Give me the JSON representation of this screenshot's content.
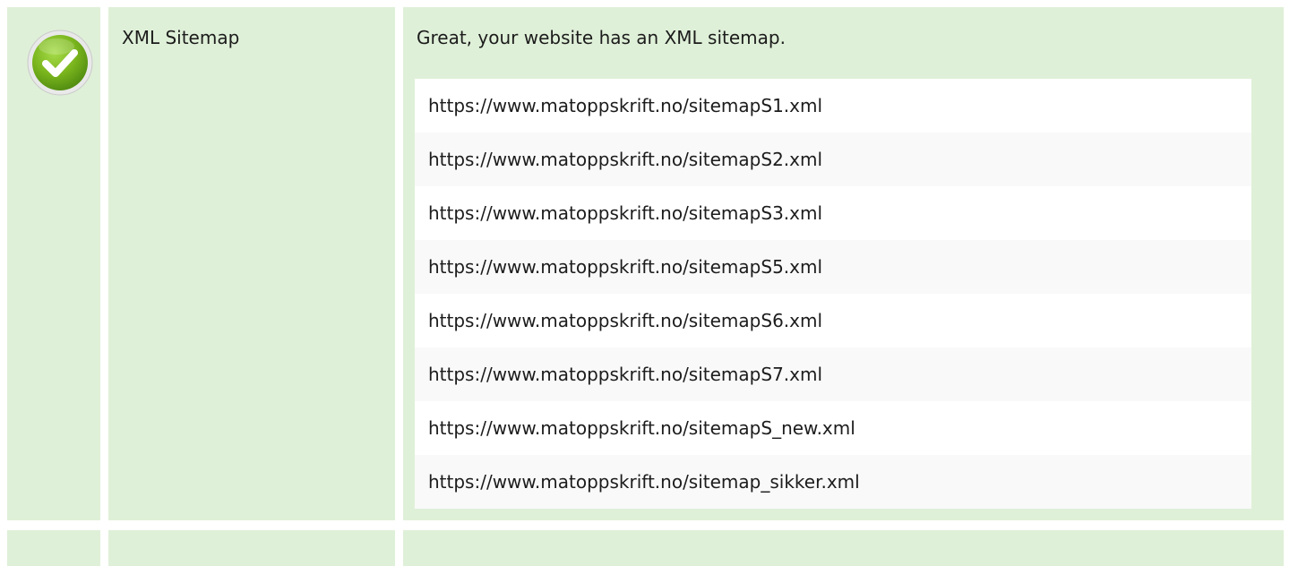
{
  "check": {
    "name": "XML Sitemap",
    "status": "pass",
    "status_icon": "check-circle-icon",
    "status_color": "#7ab51d",
    "message": "Great, your website has an XML sitemap."
  },
  "sitemaps": [
    "https://www.matoppskrift.no/sitemapS1.xml",
    "https://www.matoppskrift.no/sitemapS2.xml",
    "https://www.matoppskrift.no/sitemapS3.xml",
    "https://www.matoppskrift.no/sitemapS5.xml",
    "https://www.matoppskrift.no/sitemapS6.xml",
    "https://www.matoppskrift.no/sitemapS7.xml",
    "https://www.matoppskrift.no/sitemapS_new.xml",
    "https://www.matoppskrift.no/sitemap_sikker.xml"
  ],
  "colors": {
    "row_background": "#dff0d8",
    "list_background": "#ffffff",
    "list_stripe": "#f9f9f9"
  }
}
